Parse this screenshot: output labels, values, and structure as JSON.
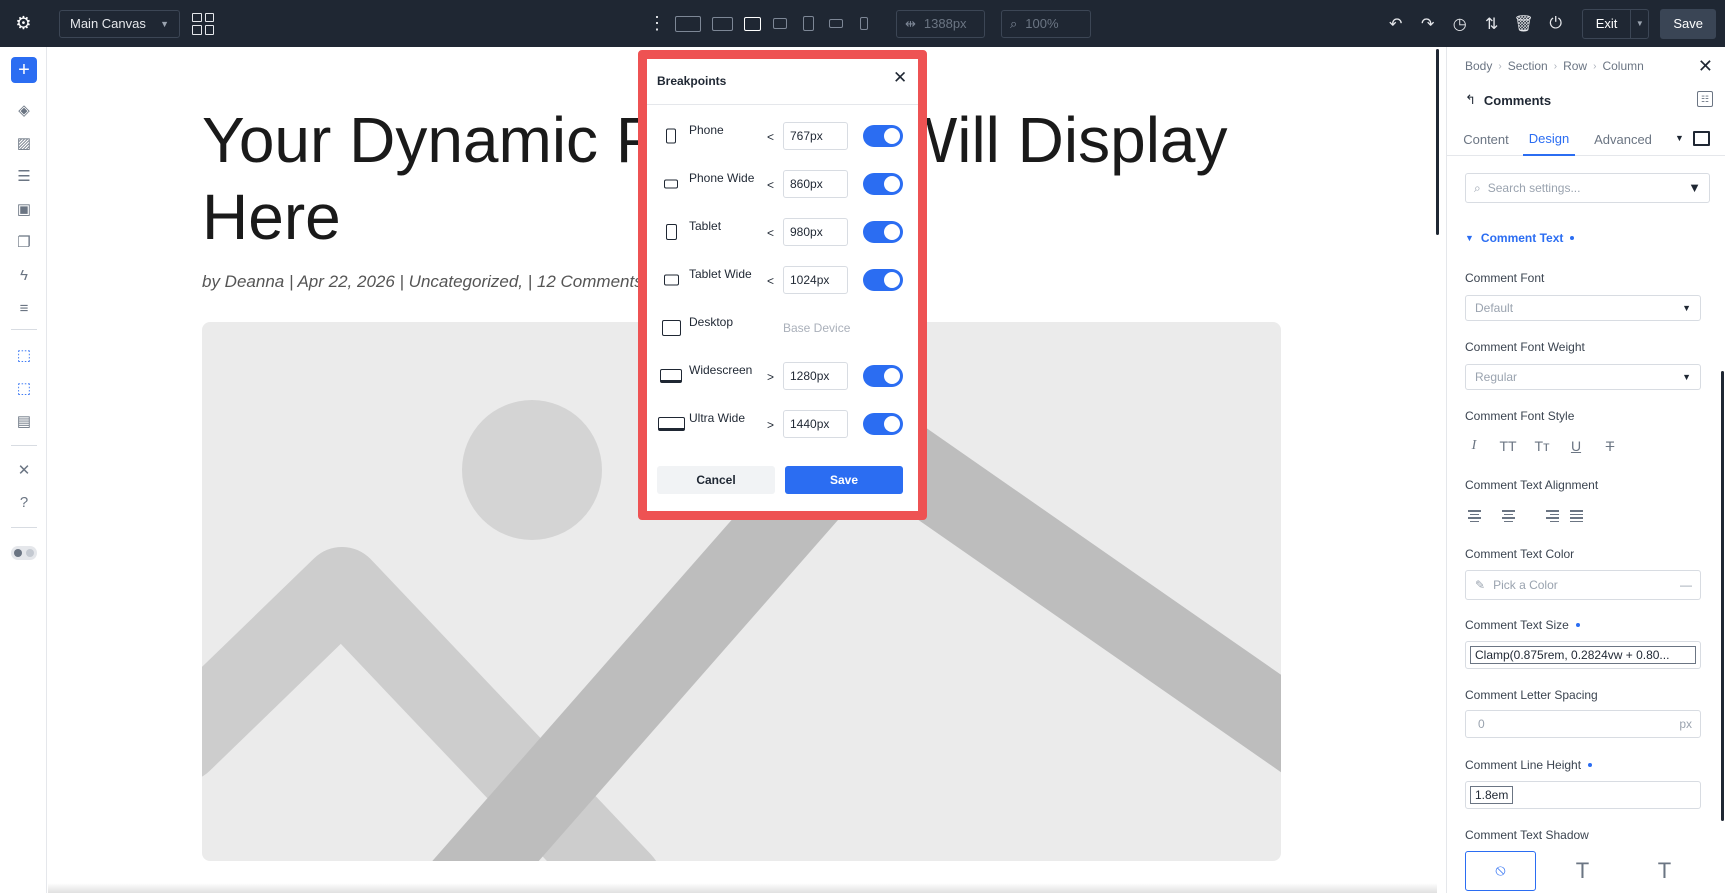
{
  "topbar": {
    "canvas_label": "Main Canvas",
    "width_value": "1388px",
    "zoom_value": "100%",
    "exit_label": "Exit",
    "save_label": "Save"
  },
  "canvas": {
    "title": "Your Dynamic Post Title Will Display Here",
    "meta": "by Deanna | Apr 22, 2026 | Uncategorized, | 12 Comments"
  },
  "panel": {
    "breadcrumbs": [
      "Body",
      "Section",
      "Row",
      "Column"
    ],
    "module_title": "Comments",
    "tabs": [
      "Content",
      "Design",
      "Advanced"
    ],
    "active_tab": "Design",
    "search_placeholder": "Search settings...",
    "section_title": "Comment Text",
    "fields": {
      "font_label": "Comment Font",
      "font_value": "Default",
      "weight_label": "Comment Font Weight",
      "weight_value": "Regular",
      "style_label": "Comment Font Style",
      "style_options": [
        "I",
        "TT",
        "Tт",
        "U",
        "T"
      ],
      "align_label": "Comment Text Alignment",
      "color_label": "Comment Text Color",
      "color_placeholder": "Pick a Color",
      "size_label": "Comment Text Size",
      "size_value": "Clamp(0.875rem, 0.2824vw + 0.80...",
      "spacing_label": "Comment Letter Spacing",
      "spacing_placeholder": "0",
      "spacing_unit": "px",
      "line_height_label": "Comment Line Height",
      "line_height_value": "1.8em",
      "shadow_label": "Comment Text Shadow",
      "shadow_options": [
        "none",
        "T",
        "T"
      ]
    }
  },
  "modal": {
    "title": "Breakpoints",
    "rows": [
      {
        "label": "Phone",
        "op": "<",
        "value": "767px",
        "enabled": true
      },
      {
        "label": "Phone Wide",
        "op": "<",
        "value": "860px",
        "enabled": true
      },
      {
        "label": "Tablet",
        "op": "<",
        "value": "980px",
        "enabled": true
      },
      {
        "label": "Tablet Wide",
        "op": "<",
        "value": "1024px",
        "enabled": true
      },
      {
        "label": "Desktop",
        "op": "",
        "value": "Base Device",
        "enabled": null
      },
      {
        "label": "Widescreen",
        "op": ">",
        "value": "1280px",
        "enabled": true
      },
      {
        "label": "Ultra Wide",
        "op": ">",
        "value": "1440px",
        "enabled": true
      }
    ],
    "cancel_label": "Cancel",
    "save_label": "Save"
  }
}
